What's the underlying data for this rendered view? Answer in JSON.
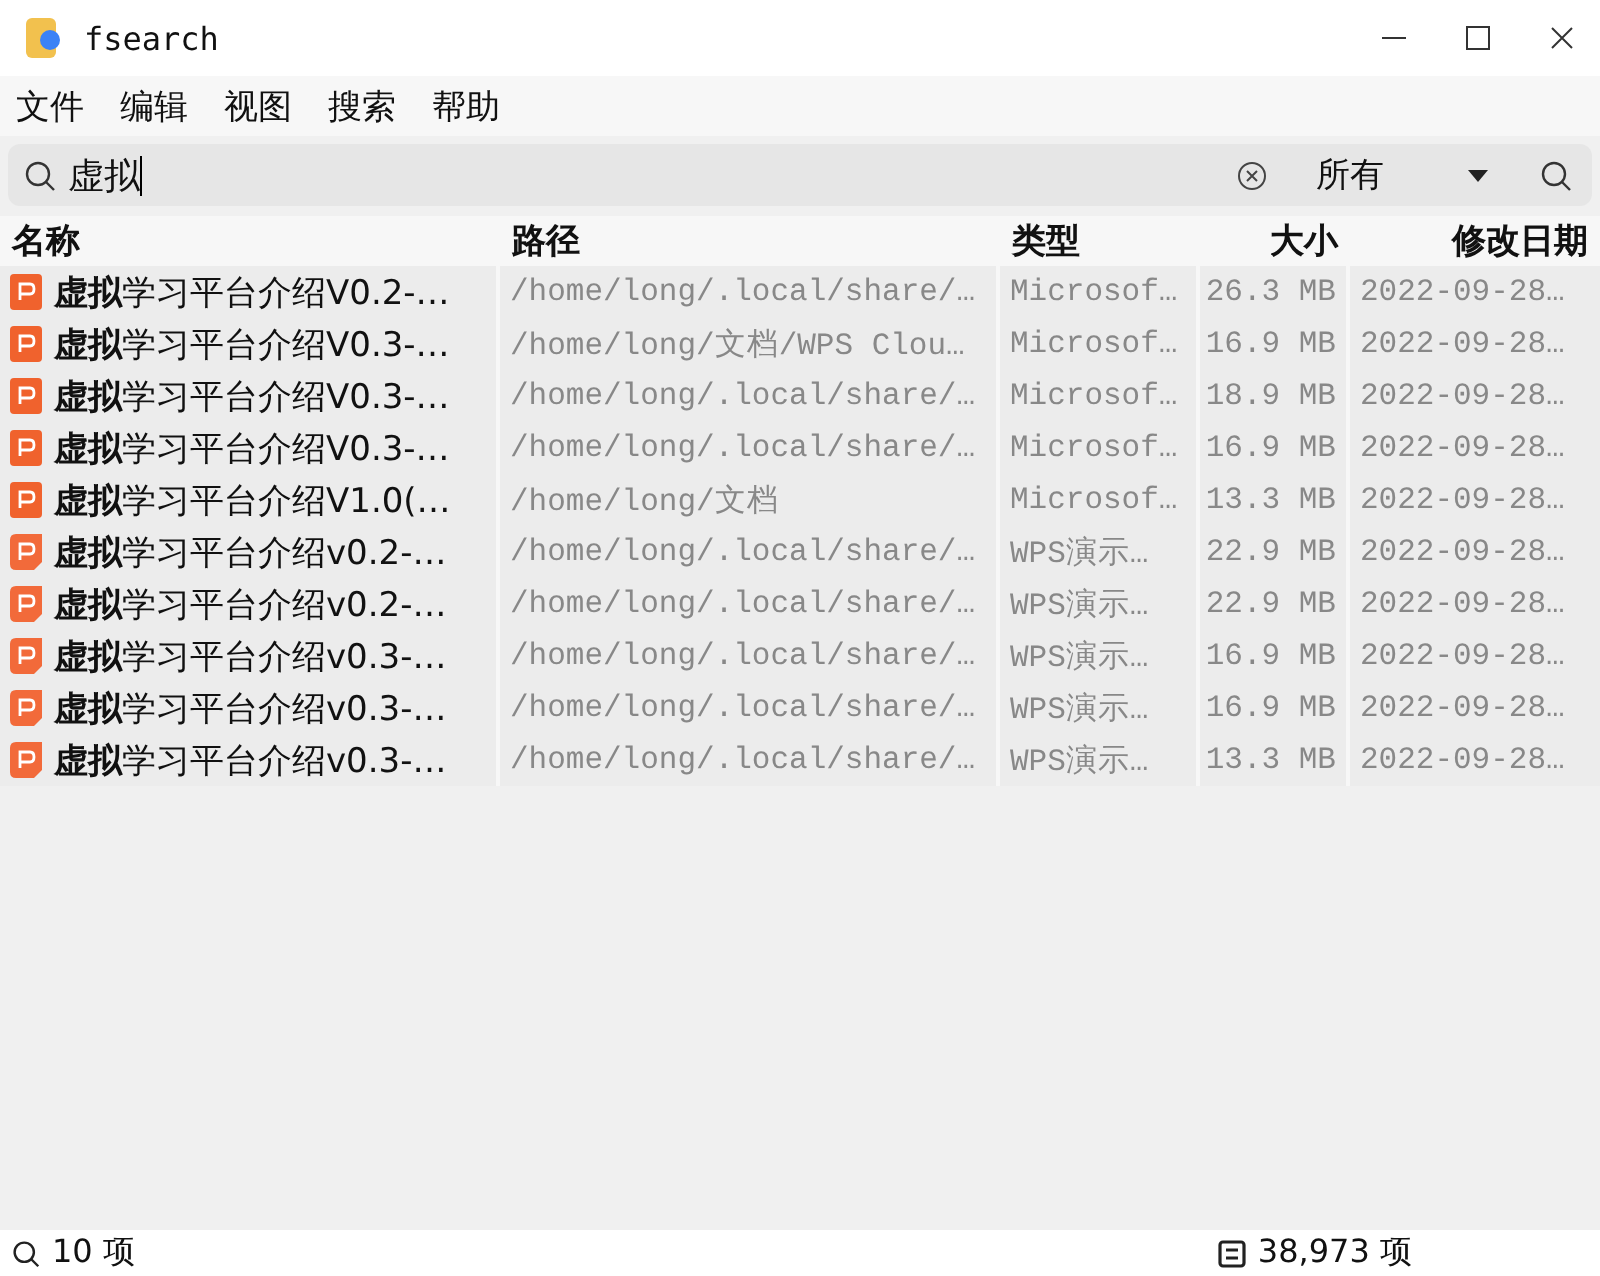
{
  "window": {
    "title": "fsearch"
  },
  "menu": [
    "文件",
    "编辑",
    "视图",
    "搜索",
    "帮助"
  ],
  "search": {
    "value": "虚拟",
    "filter": "所有"
  },
  "table": {
    "columns": [
      "名称",
      "路径",
      "类型",
      "大小",
      "修改日期"
    ],
    "rows": [
      {
        "kind": "pptx",
        "name": "**虚拟**学习平台介绍V0.2-…",
        "path": "/home/long/.local/share/…",
        "type": "Microsof…",
        "size": "26.3 MB",
        "date": "2022-09-28…"
      },
      {
        "kind": "pptx",
        "name": "**虚拟**学习平台介绍V0.3-…",
        "path": "/home/long/文档/WPS Clou…",
        "type": "Microsof…",
        "size": "16.9 MB",
        "date": "2022-09-28…"
      },
      {
        "kind": "pptx",
        "name": "**虚拟**学习平台介绍V0.3-…",
        "path": "/home/long/.local/share/…",
        "type": "Microsof…",
        "size": "18.9 MB",
        "date": "2022-09-28…"
      },
      {
        "kind": "pptx",
        "name": "**虚拟**学习平台介绍V0.3-…",
        "path": "/home/long/.local/share/…",
        "type": "Microsof…",
        "size": "16.9 MB",
        "date": "2022-09-28…"
      },
      {
        "kind": "pptx",
        "name": "**虚拟**学习平台介绍V1.0(…",
        "path": "/home/long/文档",
        "type": "Microsof…",
        "size": "13.3 MB",
        "date": "2022-09-28…"
      },
      {
        "kind": "wps",
        "name": "**虚拟**学习平台介绍v0.2-…",
        "path": "/home/long/.local/share/…",
        "type": "WPS演示…",
        "size": "22.9 MB",
        "date": "2022-09-28…"
      },
      {
        "kind": "wps",
        "name": "**虚拟**学习平台介绍v0.2-…",
        "path": "/home/long/.local/share/…",
        "type": "WPS演示…",
        "size": "22.9 MB",
        "date": "2022-09-28…"
      },
      {
        "kind": "wps",
        "name": "**虚拟**学习平台介绍v0.3-…",
        "path": "/home/long/.local/share/…",
        "type": "WPS演示…",
        "size": "16.9 MB",
        "date": "2022-09-28…"
      },
      {
        "kind": "wps",
        "name": "**虚拟**学习平台介绍v0.3-…",
        "path": "/home/long/.local/share/…",
        "type": "WPS演示…",
        "size": "16.9 MB",
        "date": "2022-09-28…"
      },
      {
        "kind": "wps",
        "name": "**虚拟**学习平台介绍v0.3-…",
        "path": "/home/long/.local/share/…",
        "type": "WPS演示…",
        "size": "13.3 MB",
        "date": "2022-09-28…"
      }
    ]
  },
  "status_bar": {
    "results": "10 项",
    "total": "38,973 项"
  }
}
